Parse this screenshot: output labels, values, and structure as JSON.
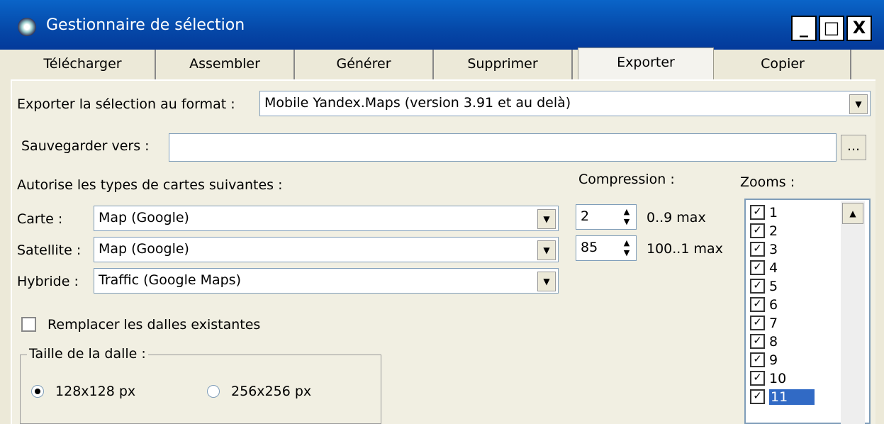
{
  "window": {
    "title": "Gestionnaire de sélection",
    "min_label": "_",
    "max_label": "□",
    "close_label": "X"
  },
  "tabs": [
    {
      "label": "Télécharger"
    },
    {
      "label": "Assembler"
    },
    {
      "label": "Générer"
    },
    {
      "label": "Supprimer"
    },
    {
      "label": "Exporter",
      "active": true
    },
    {
      "label": "Copier"
    }
  ],
  "export": {
    "format_label": "Exporter la sélection au format :",
    "format_value": "Mobile Yandex.Maps (version 3.91 et au delà)",
    "save_label": "Sauvegarder vers :",
    "save_value": "",
    "browse_label": "..."
  },
  "map_types": {
    "heading": "Autorise les types de cartes suivantes :",
    "carte_label": "Carte :",
    "carte_value": "Map (Google)",
    "satellite_label": "Satellite :",
    "satellite_value": "Map (Google)",
    "hybride_label": "Hybride :",
    "hybride_value": "Traffic (Google Maps)"
  },
  "compression": {
    "heading": "Compression :",
    "value1": "2",
    "range1": "0..9 max",
    "value2": "85",
    "range2": "100..1 max"
  },
  "replace_tiles": {
    "label": "Remplacer les dalles existantes",
    "checked": false
  },
  "tile_size": {
    "legend": "Taille de la dalle :",
    "option1": "128x128 px",
    "option2": "256x256 px",
    "selected": "128x128 px"
  },
  "zooms": {
    "heading": "Zooms :",
    "items": [
      "1",
      "2",
      "3",
      "4",
      "5",
      "6",
      "7",
      "8",
      "9",
      "10",
      "11"
    ],
    "selected": "11"
  },
  "colors": {
    "titlebar": "#0548a8",
    "selection": "#316ac5"
  }
}
